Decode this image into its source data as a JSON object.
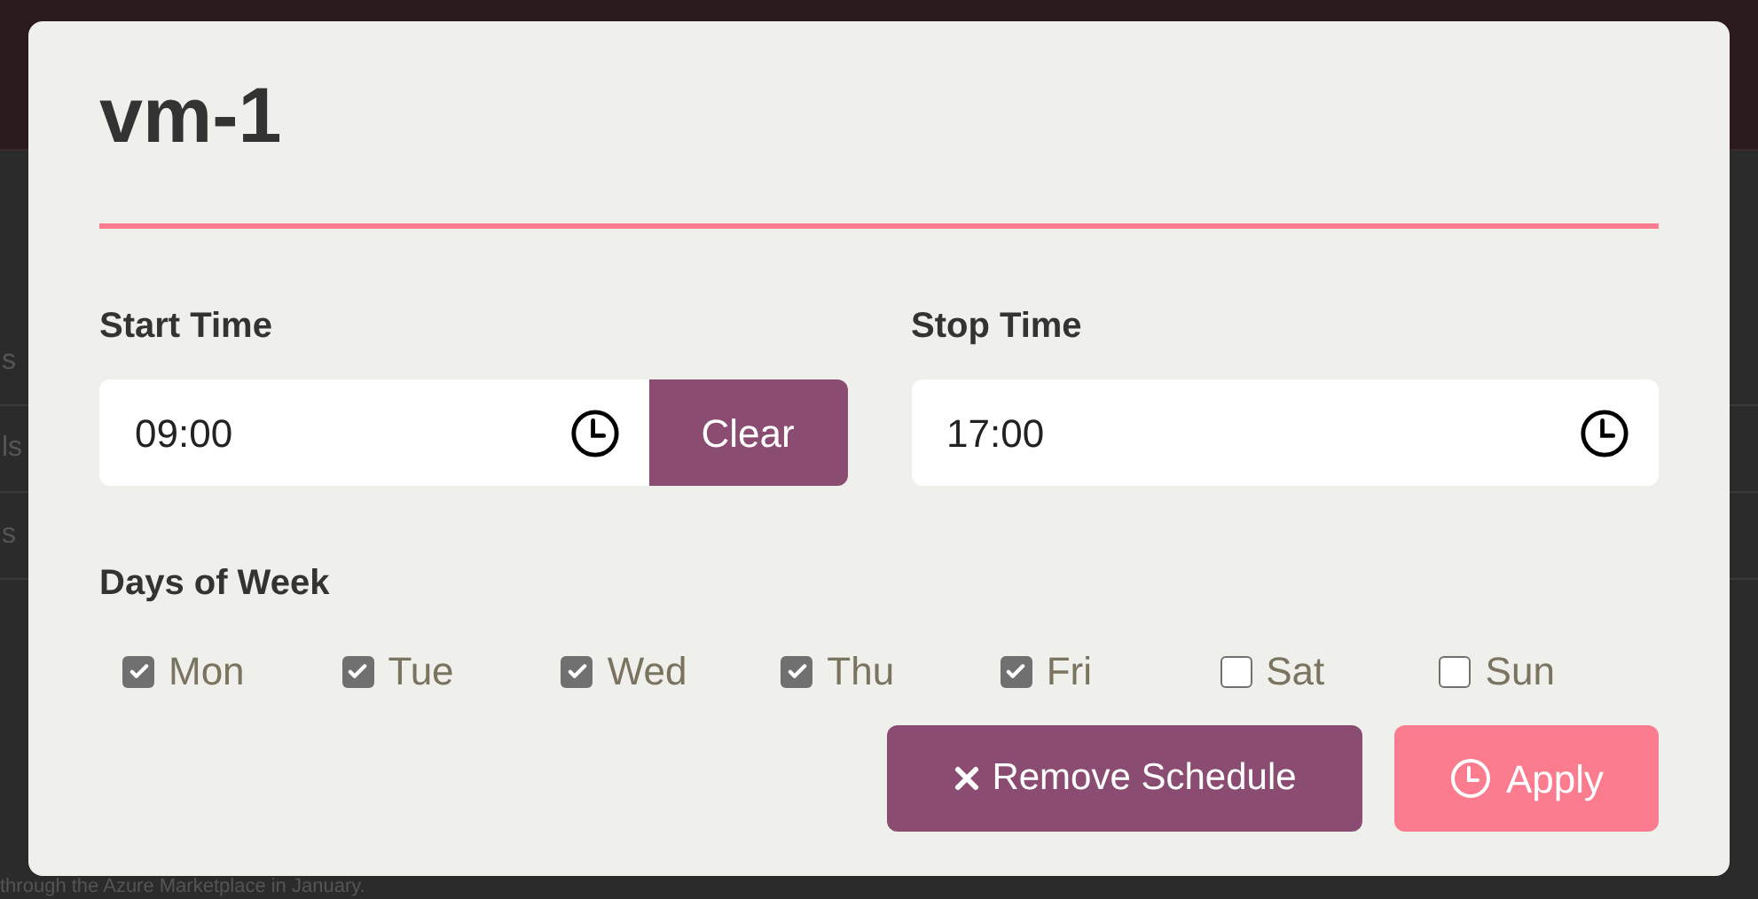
{
  "background": {
    "fragments": [
      "s",
      "ls",
      "s"
    ],
    "footer_text": "through the Azure Marketplace in January."
  },
  "dialog": {
    "title": "vm-1",
    "start_time": {
      "label": "Start Time",
      "value": "09:00",
      "clear_button": "Clear"
    },
    "stop_time": {
      "label": "Stop Time",
      "value": "17:00"
    },
    "days_label": "Days of Week",
    "days": [
      {
        "label": "Mon",
        "checked": true
      },
      {
        "label": "Tue",
        "checked": true
      },
      {
        "label": "Wed",
        "checked": true
      },
      {
        "label": "Thu",
        "checked": true
      },
      {
        "label": "Fri",
        "checked": true
      },
      {
        "label": "Sat",
        "checked": false
      },
      {
        "label": "Sun",
        "checked": false
      }
    ],
    "buttons": [
      {
        "kind": "remove",
        "label": "Remove Schedule"
      },
      {
        "kind": "apply",
        "label": "Apply"
      }
    ]
  }
}
